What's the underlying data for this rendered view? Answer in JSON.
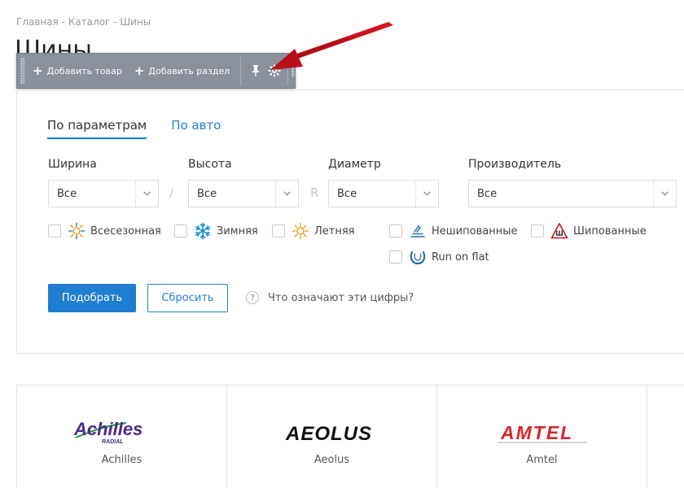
{
  "breadcrumb": {
    "items": [
      "Главная",
      "Каталог",
      "Шины"
    ],
    "separator": " - "
  },
  "page_title": "Шины",
  "admin_toolbar": {
    "add_product_label": "Добавить товар",
    "add_section_label": "Добавить раздел",
    "pin_icon": "pin-icon",
    "settings_icon": "gear-icon"
  },
  "tabs": [
    {
      "label": "По параметрам",
      "active": true
    },
    {
      "label": "По авто",
      "active": false
    }
  ],
  "filters": {
    "width": {
      "label": "Ширина",
      "value": "Все"
    },
    "height": {
      "label": "Высота",
      "value": "Все"
    },
    "diameter": {
      "label": "Диаметр",
      "value": "Все"
    },
    "manufacturer": {
      "label": "Производитель",
      "value": "Все"
    },
    "separator_slash": "/",
    "separator_r": "R"
  },
  "checkboxes": {
    "allseason": {
      "label": "Всесезонная",
      "checked": false
    },
    "winter": {
      "label": "Зимняя",
      "checked": false
    },
    "summer": {
      "label": "Летняя",
      "checked": false
    },
    "nonstudded": {
      "label": "Нешипованные",
      "checked": false
    },
    "studded": {
      "label": "Шипованные",
      "checked": false
    },
    "runflat": {
      "label": "Run on flat",
      "checked": false
    }
  },
  "actions": {
    "submit_label": "Подобрать",
    "reset_label": "Сбросить",
    "help_glyph": "?",
    "help_label": "Что означают эти цифры?"
  },
  "brands": [
    {
      "name": "Achilles",
      "logo_text": "Achilles",
      "logo_sub": "RADIAL",
      "color": "#4a2a86"
    },
    {
      "name": "Aeolus",
      "logo_text": "AEOLUS",
      "color": "#111111"
    },
    {
      "name": "Amtel",
      "logo_text": "AMTEL",
      "color": "#d9262b"
    }
  ],
  "colors": {
    "accent": "#1f7ed0",
    "annotation_arrow": "#c4121a",
    "toolbar": "#8a919c"
  }
}
